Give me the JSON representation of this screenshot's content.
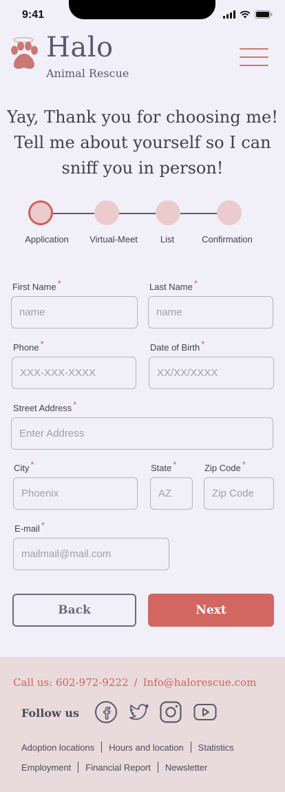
{
  "status": {
    "time": "9:41"
  },
  "brand": {
    "name": "Halo",
    "subtitle": "Animal Rescue"
  },
  "headline": "Yay, Thank you for choosing me! Tell me about yourself so I can sniff you in person!",
  "stepper": {
    "active_index": 0,
    "steps": [
      {
        "label": "Application"
      },
      {
        "label": "Virtual-Meet"
      },
      {
        "label": "List"
      },
      {
        "label": "Confirmation"
      }
    ]
  },
  "form": {
    "required_mark": "*",
    "first_name": {
      "label": "First Name",
      "placeholder": "name",
      "value": ""
    },
    "last_name": {
      "label": "Last Name",
      "placeholder": "name",
      "value": ""
    },
    "phone": {
      "label": "Phone",
      "placeholder": "XXX-XXX-XXXX",
      "value": ""
    },
    "dob": {
      "label": "Date of Birth",
      "placeholder": "XX/XX/XXXX",
      "value": ""
    },
    "street": {
      "label": "Street Address",
      "placeholder": "Enter Address",
      "value": ""
    },
    "city": {
      "label": "City",
      "placeholder": "Phoenix",
      "value": ""
    },
    "state": {
      "label": "State",
      "placeholder": "AZ",
      "value": ""
    },
    "zip": {
      "label": "Zip Code",
      "placeholder": "Zip Code",
      "value": ""
    },
    "email": {
      "label": "E-mail",
      "placeholder": "mailmail@mail.com",
      "value": ""
    }
  },
  "buttons": {
    "back": "Back",
    "next": "Next"
  },
  "footer": {
    "phone": "Call us: 602-972-9222",
    "separator": "/",
    "email": "Info@halorescue.com",
    "follow": "Follow us",
    "social_icons": [
      "facebook-icon",
      "twitter-icon",
      "instagram-icon",
      "youtube-icon"
    ],
    "links_row1": [
      "Adoption locations",
      "Hours and location",
      "Statistics"
    ],
    "links_row2": [
      "Employment",
      "Financial Report",
      "Newsletter"
    ]
  },
  "colors": {
    "background": "#f1f0f8",
    "accent": "#d26762",
    "text": "#3f3f4e",
    "step_fill": "#ebcbcc",
    "footer_bg": "#e9dbdc"
  }
}
